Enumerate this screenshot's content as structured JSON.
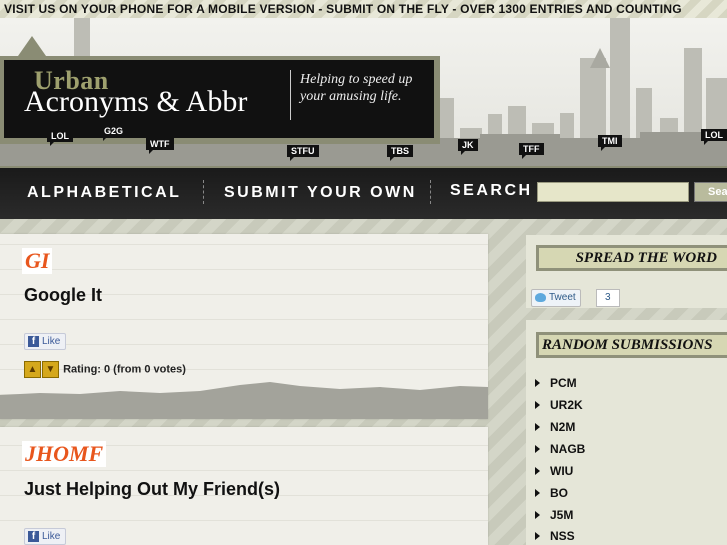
{
  "topbar": {
    "text": "VISIT US ON YOUR PHONE FOR A MOBILE VERSION - SUBMIT ON THE FLY - OVER 1300 ENTRIES AND COUNTING"
  },
  "logo": {
    "urban": "Urban",
    "title": "Acronyms & Abbr",
    "tagline": "Helping to speed up your amusing life."
  },
  "skyline_tags": [
    "LOL",
    "G2G",
    "WTF",
    "STFU",
    "TBS",
    "JK",
    "TFF",
    "TMI",
    "LOL"
  ],
  "nav": {
    "alphabetical": "ALPHABETICAL",
    "submit": "SUBMIT YOUR OWN",
    "search_label": "SEARCH",
    "search_value": "",
    "search_button": "Sea"
  },
  "entries": [
    {
      "acronym": "GI",
      "meaning": "Google It",
      "like": "Like",
      "rating": "Rating: 0 (from 0 votes)"
    },
    {
      "acronym": "JHOMF",
      "meaning": "Just Helping Out My Friend(s)",
      "like": "Like"
    }
  ],
  "sidebar": {
    "spread_title": "SPREAD THE WORD",
    "tweet_label": "Tweet",
    "tweet_count": "3",
    "random_title": "RANDOM SUBMISSIONS",
    "random": [
      "PCM",
      "UR2K",
      "N2M",
      "NAGB",
      "WIU",
      "BO",
      "J5M",
      "NSS"
    ]
  },
  "colors": {
    "accent": "#e8561d",
    "olive": "#8a8c74",
    "dark": "#111111"
  }
}
